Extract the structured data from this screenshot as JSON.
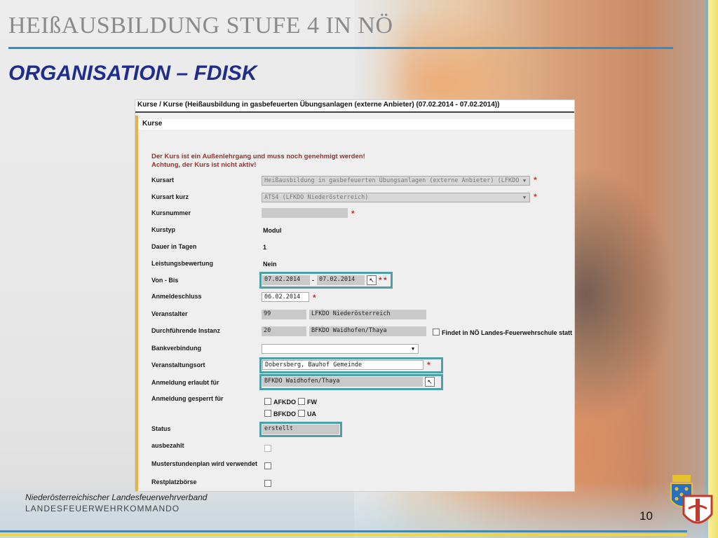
{
  "slide": {
    "title": "HEIßAUSBILDUNG STUFE 4 IN NÖ",
    "section": "ORGANISATION – FDISK",
    "footer_org": "Niederösterreichischer Landesfeuerwehrverband",
    "footer_sub": "LANDESFEUERWEHRKOMMANDO",
    "page_number": "10"
  },
  "screenshot": {
    "breadcrumb": "Kurse / Kurse (Heißausbildung in gasbefeuerten Übungsanlagen (externe Anbieter) (07.02.2014 - 07.02.2014))",
    "tab": "Kurse",
    "warning1": "Der Kurs ist ein Außenlehrgang und muss noch genehmigt werden!",
    "warning2": "Achtung, der Kurs ist nicht aktiv!",
    "required_mark": "*",
    "fields": {
      "kursart": {
        "label": "Kursart",
        "value": "Heißausbildung in gasbefeuerten Übungsanlagen (externe Anbieter) (LFKDO"
      },
      "kursart_kurz": {
        "label": "Kursart kurz",
        "value": "ATS4 (LFKDO Niederösterreich)"
      },
      "kursnummer": {
        "label": "Kursnummer",
        "value": ""
      },
      "kurstyp": {
        "label": "Kurstyp",
        "value": "Modul"
      },
      "dauer": {
        "label": "Dauer in Tagen",
        "value": "1"
      },
      "leistungsbewertung": {
        "label": "Leistungsbewertung",
        "value": "Nein"
      },
      "von_bis": {
        "label": "Von - Bis",
        "von": "07.02.2014",
        "sep": "-",
        "bis": "07.02.2014"
      },
      "anmeldeschluss": {
        "label": "Anmeldeschluss",
        "value": "06.02.2014"
      },
      "veranstalter": {
        "label": "Veranstalter",
        "code": "99",
        "name": "LFKDO Niederösterreich"
      },
      "durchfuehrende": {
        "label": "Durchführende Instanz",
        "code": "20",
        "name": "BFKDO Waidhofen/Thaya",
        "checkbox_label": "Findet in NÖ Landes-Feuerwehrschule statt"
      },
      "bankverbindung": {
        "label": "Bankverbindung",
        "value": ""
      },
      "veranstaltungsort": {
        "label": "Veranstaltungsort",
        "value": "Dobersberg, Bauhof Gemeinde"
      },
      "anmeldung_erlaubt": {
        "label": "Anmeldung erlaubt für",
        "value": "BFKDO Waidhofen/Thaya"
      },
      "anmeldung_gesperrt": {
        "label": "Anmeldung gesperrt für",
        "options": [
          "AFKDO",
          "FW",
          "BFKDO",
          "UA"
        ]
      },
      "status": {
        "label": "Status",
        "value": "erstellt"
      },
      "ausbezahlt": {
        "label": "ausbezahlt"
      },
      "musterstundenplan": {
        "label": "Musterstundenplan wird verwendet"
      },
      "restplatzboerse": {
        "label": "Restplatzbörse"
      }
    }
  },
  "colors": {
    "accent_blue": "#2a8fd0",
    "title_navy": "#1f2e8c",
    "warning_red": "#a0322b",
    "highlight_teal": "#4f9fa8"
  }
}
